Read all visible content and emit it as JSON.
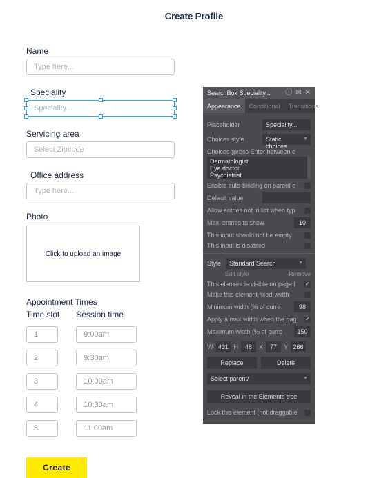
{
  "page_title": "Create Profile",
  "labels": {
    "name": "Name",
    "speciality": "Speciality",
    "servicing_area": "Servicing area",
    "office_address": "Office address",
    "photo": "Photo",
    "appointment_times": "Appointment Times",
    "time_slot": "Time slot",
    "session_time": "Session time"
  },
  "placeholders": {
    "name": "Type here...",
    "speciality": "Speciality...",
    "zipcode": "Select Zipcode",
    "address": "Type here..."
  },
  "photo_prompt": "Click to upload an image",
  "time_slots": [
    "1",
    "2",
    "3",
    "4",
    "5"
  ],
  "session_times": [
    "9:00am",
    "9:30am",
    "10:00am",
    "10:30am",
    "11:00am"
  ],
  "create_button": "Create",
  "inspector": {
    "title": "SearchBox Speciality...",
    "tabs": {
      "appearance": "Appearance",
      "conditional": "Conditional",
      "transitions": "Transitions"
    },
    "rows": {
      "placeholder_label": "Placeholder",
      "placeholder_value": "Speciality...",
      "choices_style_label": "Choices style",
      "choices_style_value": "Static choices",
      "choices_label": "Choices (press Enter between e",
      "choices_items": [
        "Dermatologist",
        "Eye doctor",
        "Psychiatrist"
      ],
      "enable_autobind": "Enable auto-binding on parent e",
      "default_value_label": "Default value",
      "allow_entries": "Allow entries not in list when typ",
      "max_entries_label": "Max. entries to show",
      "max_entries_value": "10",
      "not_empty": "This input should not be empty",
      "disabled": "This input is disabled",
      "style_label": "Style",
      "style_value": "Standard Search",
      "edit_style": "Edit style",
      "remove_style": "Remove",
      "visible": "This element is visible on page l",
      "fixed_width": "Make this element fixed-width",
      "min_width_label": "Minimum width (% of curre",
      "min_width_value": "98",
      "apply_max": "Apply a max width when the pag",
      "max_width_label": "Maximum width (% of curre",
      "max_width_value": "150",
      "coords": {
        "w_label": "W",
        "w": "431",
        "h_label": "H",
        "h": "48",
        "x_label": "X",
        "x": "77",
        "y_label": "Y",
        "y": "266"
      },
      "replace": "Replace",
      "delete": "Delete",
      "select_parent": "Select parent/",
      "reveal": "Reveal in the Elements tree",
      "lock": "Lock this element (not draggable"
    }
  }
}
